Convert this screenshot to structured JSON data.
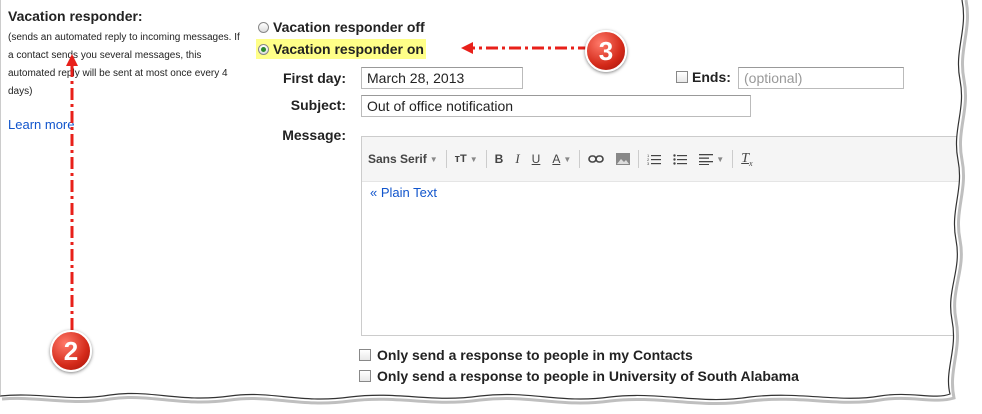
{
  "left": {
    "title": "Vacation responder:",
    "description": "(sends an automated reply to incoming messages. If a contact sends you several messages, this automated reply will be sent at most once every 4 days)",
    "learn_more": "Learn more"
  },
  "responder": {
    "off_label": "Vacation responder off",
    "on_label": "Vacation responder on",
    "selected": "on"
  },
  "form": {
    "first_day_label": "First day:",
    "first_day_value": "March 28, 2013",
    "ends_label": "Ends:",
    "ends_placeholder": "(optional)",
    "subject_label": "Subject:",
    "subject_value": "Out of office notification",
    "message_label": "Message:"
  },
  "toolbar": {
    "font": "Sans Serif",
    "size_icon": "text-size-icon",
    "bold": "B",
    "italic": "I",
    "underline": "U",
    "text_color": "A",
    "link_icon": "link-icon",
    "image_icon": "image-icon",
    "numbered_list_icon": "numbered-list-icon",
    "bulleted_list_icon": "bulleted-list-icon",
    "align_icon": "align-icon",
    "clear_format_icon": "clear-formatting-icon"
  },
  "editor": {
    "plain_text_link": "« Plain Text",
    "message_value": ""
  },
  "options": {
    "contacts_only": "Only send a response to people in my Contacts",
    "domain_only": "Only send a response to people in University of South Alabama"
  },
  "annotations": {
    "badge_2": "2",
    "badge_3": "3",
    "arrow_color": "#e8201a"
  },
  "colors": {
    "link": "#1155cc",
    "highlight": "#ffff88",
    "radio_checked": "#2a8a2a"
  }
}
